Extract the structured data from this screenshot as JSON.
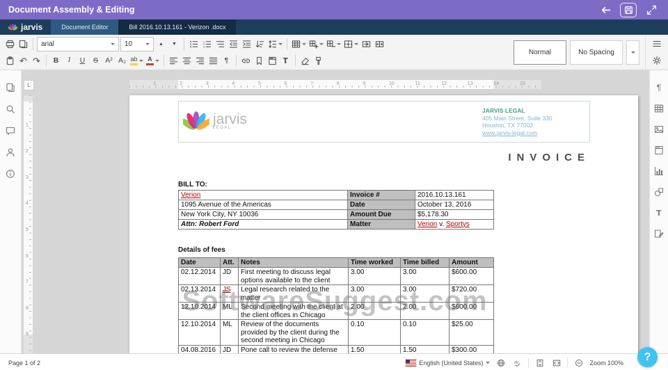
{
  "titlebar": {
    "title": "Document Assembly & Editing"
  },
  "tabbar": {
    "brand": "jarvis",
    "doc_tab": "Document Editor",
    "file_tab": "Bill 2016.10.13.161 - Verizon .docx"
  },
  "toolbar": {
    "font_family": "arial",
    "font_size": "10",
    "style_normal": "Normal",
    "style_no_spacing": "No Spacing",
    "glyphs": {
      "bold": "B",
      "italic": "I",
      "underline": "U",
      "strike": "S",
      "superscript": "A²",
      "subscript": "A₂",
      "highlight": "ab",
      "font_color": "A",
      "undo": "↶",
      "redo": "↷",
      "grow": "▲",
      "shrink": "▼",
      "paragraph": "¶"
    }
  },
  "rulers": {
    "tab_stop": "L",
    "h": [
      "1",
      "2",
      "3",
      "4",
      "5",
      "6",
      "7",
      "8",
      "9",
      "10",
      "11",
      "12",
      "13",
      "14",
      "15"
    ],
    "v": [
      "1",
      "2",
      "3",
      "4",
      "5",
      "6",
      "7",
      "8",
      "9"
    ]
  },
  "document": {
    "logo": {
      "name": "jarvis",
      "sub": "LEGAL"
    },
    "firm": {
      "name": "JARVIS LEGAL",
      "address1": "405 Main Street, Suite 330",
      "address2": "Houston, TX 77002",
      "website": "www.jarvis-legal.com"
    },
    "invoice_title": "INVOICE",
    "bill_to": {
      "label": "BILL TO:",
      "client": "Verion",
      "address1": "1095 Avenue of the Americas",
      "address2": "New York City, NY 10036",
      "attn_label": "Attn:",
      "attn_name": "Robert Ford"
    },
    "meta": {
      "invoice_label": "Invoice #",
      "invoice_value": "2016.10.13.161",
      "date_label": "Date",
      "date_value": "October 13, 2016",
      "amount_label": "Amount Due",
      "amount_value": "$5,178.30",
      "matter_label": "Matter",
      "matter_p1": "Verion",
      "matter_mid": " v. ",
      "matter_p2": "Sportys"
    },
    "fees": {
      "heading": "Details of fees",
      "columns": {
        "date": "Date",
        "att": "Att.",
        "notes": "Notes",
        "worked": "Time worked",
        "billed": "Time billed",
        "amount": "Amount"
      },
      "rows": [
        {
          "date": "02.12.2014",
          "att": "JD",
          "notes": "First meeting to discuss legal options available to the client",
          "worked": "3.00",
          "billed": "3.00",
          "amount": "$600.00"
        },
        {
          "date": "02.13.2014",
          "att": "JS",
          "notes": "Legal research related to the matter",
          "worked": "3.00",
          "billed": "3.00",
          "amount": "$720.00"
        },
        {
          "date": "12.10.2014",
          "att": "ML",
          "notes": "Second meeting with the client at the client offices in Chicago",
          "worked": "2.00",
          "billed": "2.00",
          "amount": "$600.00"
        },
        {
          "date": "12.10.2014",
          "att": "ML",
          "notes": "Review of the documents provided by the client during the second meeting in Chicago",
          "worked": "0.10",
          "billed": "0.10",
          "amount": "$25.00"
        },
        {
          "date": "04.08.2016",
          "att": "JD",
          "notes": "Pone call to review the defense options",
          "worked": "1.50",
          "billed": "1.50",
          "amount": "$300.00"
        }
      ]
    }
  },
  "watermark": "SoftwareSuggest.com",
  "statusbar": {
    "page": "Page 1 of 2",
    "language": "English (United States)",
    "zoom": "Zoom 100%",
    "help": "?"
  },
  "colors": {
    "titlebar_purple": "#7d6bc6",
    "tabbar_navy": "#1d3d5c",
    "doc_link_red": "#b30000",
    "firm_teal": "#44a18d",
    "firm_address_blue": "#85b3cf",
    "table_shade_gray": "#bfbfbf",
    "help_blue": "#40c4f1"
  }
}
